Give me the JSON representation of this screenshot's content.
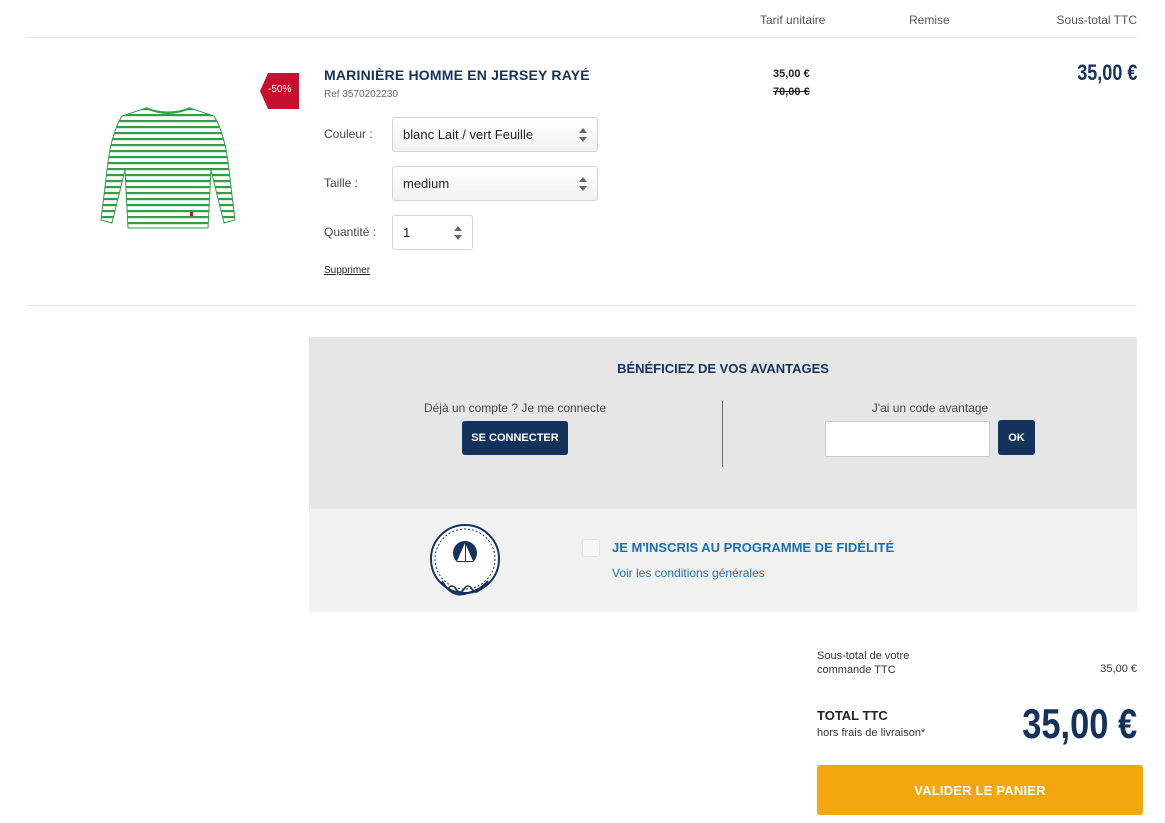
{
  "header": {
    "col_unit_price": "Tarif unitaire",
    "col_discount": "Remise",
    "col_subtotal": "Sous-total TTC"
  },
  "product": {
    "promo_badge": "-50%",
    "title": "MARINIÈRE HOMME EN JERSEY RAYÉ",
    "ref": "Ref 3570202230",
    "color_label": "Couleur :",
    "color_value": "blanc Lait / vert Feuille",
    "size_label": "Taille :",
    "size_value": "medium",
    "qty_label": "Quantité :",
    "qty_value": "1",
    "delete_label": "Supprimer",
    "price_now": "35,00 €",
    "price_old": "70,00 €",
    "line_total": "35,00 €",
    "shirt_colors": {
      "stripe": "#2f9e46",
      "base": "#ffffff"
    }
  },
  "advantages": {
    "title": "BÉNÉFICIEZ DE VOS AVANTAGES",
    "login_text": "Déjà un compte ? Je me connecte",
    "login_button": "SE CONNECTER",
    "code_text": "J'ai un code avantage",
    "code_placeholder": "",
    "ok_button": "OK"
  },
  "loyalty": {
    "logo_text_top": "PETIT BATEAU",
    "logo_text_script": "et moi",
    "title": "JE M'INSCRIS AU PROGRAMME DE FIDÉLITÉ",
    "link": "Voir les conditions générales"
  },
  "totals": {
    "subtotal_label": "Sous-total de votre commande TTC",
    "subtotal_value": "35,00 €",
    "total_label": "TOTAL TTC",
    "total_note": "hors frais de livraison*",
    "total_value": "35,00 €",
    "validate_button": "VALIDER LE PANIER"
  },
  "colors": {
    "navy": "#14325c",
    "accent_blue": "#1c6fb3",
    "promo_red": "#c8102e",
    "validate_orange": "#f4a60d"
  }
}
